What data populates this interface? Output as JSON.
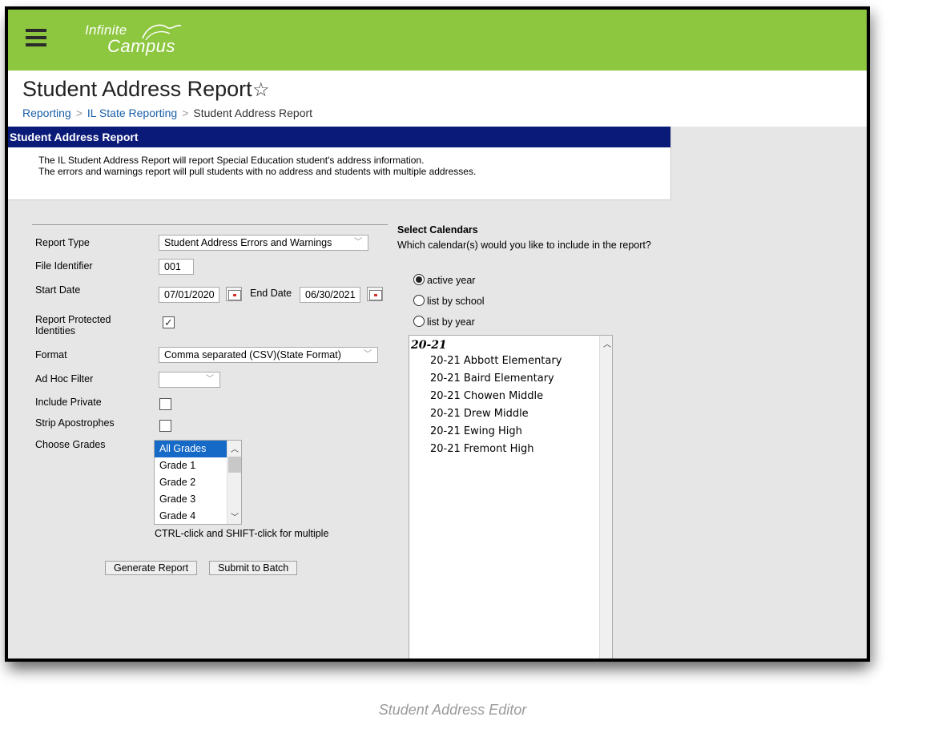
{
  "app": {
    "logo_line1": "Infinite",
    "logo_line2": "Campus"
  },
  "header": {
    "title": "Student Address Report",
    "breadcrumb": [
      "Reporting",
      "IL State Reporting",
      "Student Address Report"
    ]
  },
  "panel": {
    "title": "Student Address Report",
    "description_line1": "The IL Student Address Report will report Special Education student's address information.",
    "description_line2": "The errors and warnings report will pull students with no address and students with multiple addresses."
  },
  "form": {
    "report_type_label": "Report Type",
    "report_type_value": "Student Address Errors and Warnings",
    "file_identifier_label": "File Identifier",
    "file_identifier_value": "001",
    "start_date_label": "Start Date",
    "start_date_value": "07/01/2020",
    "end_date_label": "End Date",
    "end_date_value": "06/30/2021",
    "report_protected_label_1": "Report Protected",
    "report_protected_label_2": "Identities",
    "report_protected_checked": true,
    "format_label": "Format",
    "format_value": "Comma separated (CSV)(State Format)",
    "ad_hoc_label": "Ad Hoc Filter",
    "ad_hoc_value": "",
    "include_private_label": "Include Private",
    "include_private_checked": false,
    "strip_apostrophes_label": "Strip Apostrophes",
    "strip_apostrophes_checked": false,
    "choose_grades_label": "Choose Grades",
    "grades": [
      "All Grades",
      "Grade 1",
      "Grade 2",
      "Grade 3",
      "Grade 4"
    ],
    "selected_grade": "All Grades",
    "grades_hint": "CTRL-click and SHIFT-click for multiple",
    "generate_button": "Generate Report",
    "batch_button": "Submit to Batch"
  },
  "calendars": {
    "title": "Select Calendars",
    "question": "Which calendar(s) would you like to include in the report?",
    "options": [
      "active year",
      "list by school",
      "list by year"
    ],
    "selected_option": "active year",
    "year": "20-21",
    "schools": [
      "20-21 Abbott Elementary",
      "20-21 Baird Elementary",
      "20-21 Chowen Middle",
      "20-21 Drew Middle",
      "20-21 Ewing High",
      "20-21 Fremont High"
    ]
  },
  "caption": "Student Address Editor",
  "colors": {
    "topbar": "#8dc63f",
    "panel_header": "#0a1a78",
    "link": "#1a5fa8",
    "selection": "#1569c7"
  },
  "icons": [
    "menu-icon",
    "star-icon",
    "calendar-icon",
    "chevron-down-icon",
    "radio-icon",
    "checkbox-icon"
  ]
}
